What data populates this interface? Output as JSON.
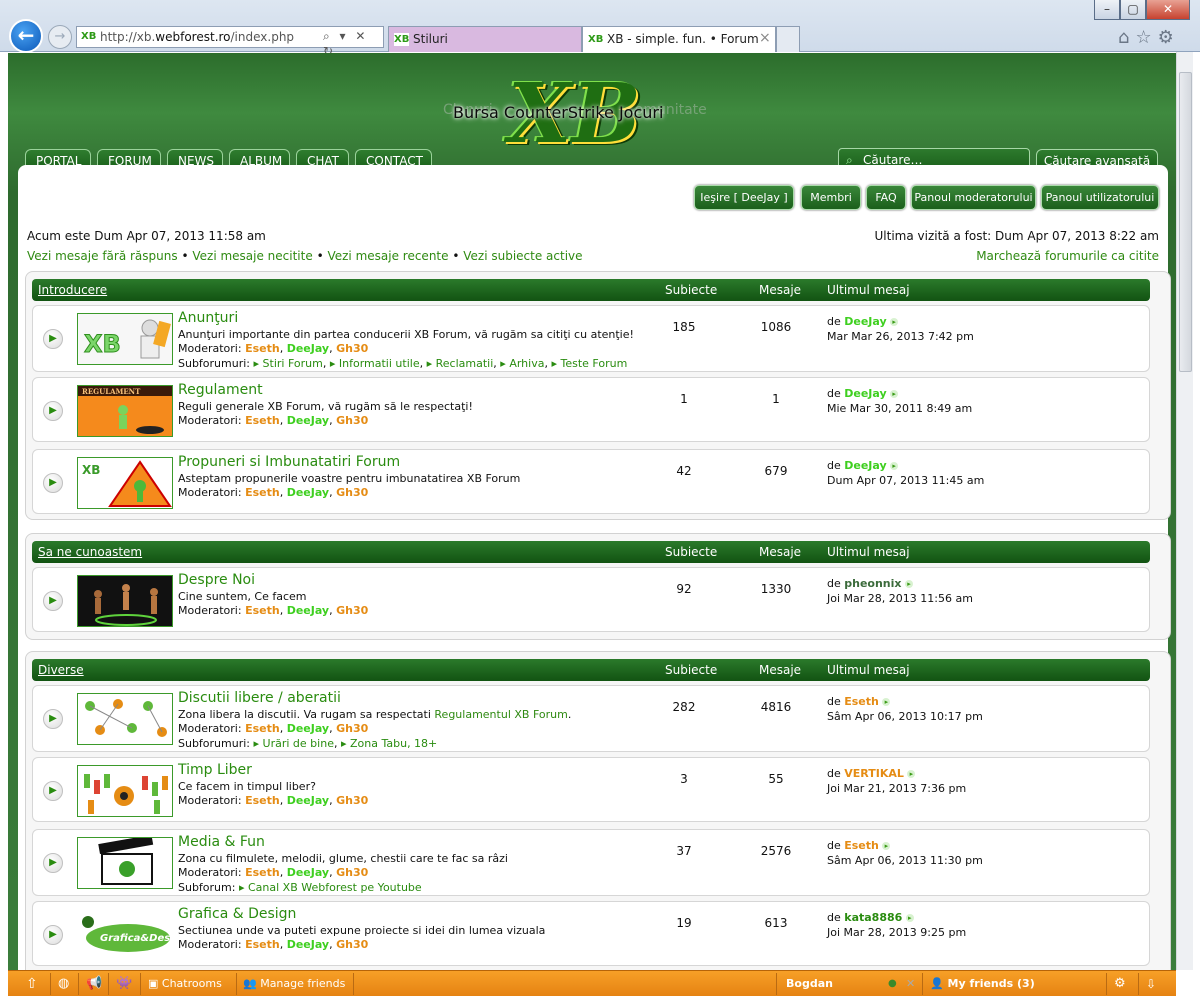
{
  "browser": {
    "url_prefix": "http://xb.",
    "url_domain": "webforest.ro",
    "url_suffix": "/index.php",
    "url_controls": "⌕ ▾ ✕ ↻",
    "tabs": [
      {
        "title": "Stiluri",
        "active": false
      },
      {
        "title": "XB - simple. fun. • Forum",
        "active": true
      }
    ],
    "tab_close": "×",
    "favicon_text": "XB",
    "window_controls": [
      "–",
      "▢",
      "✕"
    ],
    "toolbar_icons": [
      "home-icon",
      "star-icon",
      "gear-icon"
    ]
  },
  "header": {
    "logo_text": "XB",
    "tagline": "Bursa  CounterStrike  Jocuri",
    "tagline_faded_left": "Clanuri",
    "tagline_faded_right": "Comunitate",
    "nav": [
      "PORTAL",
      "FORUM",
      "NEWS",
      "ALBUM",
      "CHAT",
      "CONTACT"
    ],
    "search_placeholder": "Căutare…",
    "advanced_search": "Căutare avansată"
  },
  "user_links": [
    "Ieşire [ DeeJay ]",
    "Membri",
    "FAQ",
    "Panoul moderatorului",
    "Panoul utilizatorului"
  ],
  "info": {
    "now": "Acum este Dum Apr 07, 2013 11:58 am",
    "last_visit": "Ultima vizită a fost: Dum Apr 07, 2013 8:22 am",
    "quick_links": [
      "Vezi mesaje fără răspuns",
      "Vezi mesaje necitite",
      "Vezi mesaje recente",
      "Vezi subiecte active"
    ],
    "mark_read": "Marchează forumurile ca citite"
  },
  "columns": {
    "topics": "Subiecte",
    "posts": "Mesaje",
    "last_post": "Ultimul mesaj"
  },
  "labels": {
    "moderators": "Moderatori:",
    "subforums": "Subforumuri:",
    "subforum": "Subforum:",
    "by": "de",
    "bullet": "•",
    "comma": ",",
    "subforum_icon": "▸"
  },
  "moderators": [
    "Eseth",
    "DeeJay",
    "Gh30"
  ],
  "categories": [
    {
      "name": "Introducere",
      "forums": [
        {
          "title": "Anunţuri",
          "desc": "Anunţuri importante din partea conducerii XB Forum, vă rugăm sa citiţi cu atenţie!",
          "subforums": [
            "Stiri Forum",
            "Informatii utile",
            "Reclamatii",
            "Arhiva",
            "Teste Forum"
          ],
          "topics": "185",
          "posts": "1086",
          "last_by": "DeeJay",
          "last_date": "Mar Mar 26, 2013 7:42 pm"
        },
        {
          "title": "Regulament",
          "desc": "Reguli generale XB Forum, vă rugăm să le respectaţi!",
          "topics": "1",
          "posts": "1",
          "last_by": "DeeJay",
          "last_date": "Mie Mar 30, 2011 8:49 am"
        },
        {
          "title": "Propuneri si Imbunatatiri Forum",
          "desc": "Asteptam propunerile voastre pentru imbunatatirea XB Forum",
          "topics": "42",
          "posts": "679",
          "last_by": "DeeJay",
          "last_date": "Dum Apr 07, 2013 11:45 am"
        }
      ]
    },
    {
      "name": "Sa ne cunoastem",
      "forums": [
        {
          "title": "Despre Noi",
          "desc": "Cine suntem, Ce facem",
          "topics": "92",
          "posts": "1330",
          "last_by": "pheonnix",
          "last_date": "Joi Mar 28, 2013 11:56 am"
        }
      ]
    },
    {
      "name": "Diverse",
      "forums": [
        {
          "title": "Discutii libere / aberatii",
          "desc": "Zona libera la discutii. Va rugam sa respectati ",
          "desc_link": "Regulamentul XB Forum",
          "desc_end": ".",
          "subforums": [
            "Urări de bine",
            "Zona Tabu, 18+"
          ],
          "topics": "282",
          "posts": "4816",
          "last_by": "Eseth",
          "last_date": "Sâm Apr 06, 2013 10:17 pm"
        },
        {
          "title": "Timp Liber",
          "desc": "Ce facem in timpul liber?",
          "topics": "3",
          "posts": "55",
          "last_by": "VERTIKAL",
          "last_date": "Joi Mar 21, 2013 7:36 pm"
        },
        {
          "title": "Media & Fun",
          "desc": "Zona cu filmulete, melodii, glume, chestii care te fac sa râzi",
          "subforum_single": "Canal XB Webforest pe Youtube",
          "topics": "37",
          "posts": "2576",
          "last_by": "Eseth",
          "last_date": "Sâm Apr 06, 2013 11:30 pm"
        },
        {
          "title": "Grafica & Design",
          "desc": "Sectiunea unde va puteti expune proiecte si idei din lumea vizuala",
          "topics": "19",
          "posts": "613",
          "last_by": "kata8886",
          "last_date": "Joi Mar 28, 2013 9:25 pm"
        }
      ]
    }
  ],
  "thumbs": {
    "regulament": "REGULAMENT",
    "grafica": "Grafica&Design"
  },
  "footer_bar": {
    "chatrooms": "Chatrooms",
    "manage_friends": "Manage friends",
    "user": "Bogdan",
    "friends": "My friends (3)"
  },
  "colors": {
    "brand_green": "#2a8c10",
    "moderator_orange": "#e58c14",
    "moderator_green": "#3ecf1f",
    "footer_orange": "#f39a1e"
  }
}
